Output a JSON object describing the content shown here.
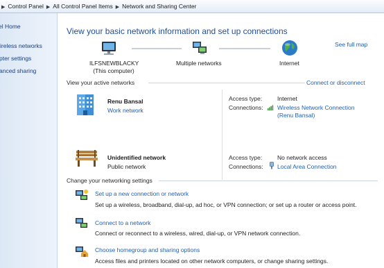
{
  "breadcrumb": {
    "items": [
      "Control Panel",
      "All Control Panel Items",
      "Network and Sharing Center"
    ]
  },
  "leftnav": {
    "items": [
      "el Home",
      "ireless networks",
      "pter settings",
      "anced sharing"
    ]
  },
  "header": {
    "title": "View your basic network information and set up connections",
    "see_full_map": "See full map"
  },
  "map": {
    "computer_name": "ILFSNEWBLACKY",
    "computer_sub": "(This computer)",
    "networks_label": "Multiple networks",
    "internet_label": "Internet"
  },
  "active": {
    "heading": "View your active networks",
    "connect_link": "Connect or disconnect",
    "networks": [
      {
        "name": "Renu Bansal",
        "type": "Work network",
        "access_label": "Access type:",
        "access_value": "Internet",
        "connections_label": "Connections:",
        "connection_line1": "Wireless Network Connection",
        "connection_line2": "(Renu Bansal)"
      },
      {
        "name": "Unidentified network",
        "type": "Public network",
        "access_label": "Access type:",
        "access_value": "No network access",
        "connections_label": "Connections:",
        "connection_line1": "Local Area Connection"
      }
    ]
  },
  "settings": {
    "heading": "Change your networking settings",
    "items": [
      {
        "title": "Set up a new connection or network",
        "desc": "Set up a wireless, broadband, dial-up, ad hoc, or VPN connection; or set up a router or access point."
      },
      {
        "title": "Connect to a network",
        "desc": "Connect or reconnect to a wireless, wired, dial-up, or VPN network connection."
      },
      {
        "title": "Choose homegroup and sharing options",
        "desc": "Access files and printers located on other network computers, or change sharing settings."
      }
    ]
  },
  "colors": {
    "link": "#1f5fb4",
    "title": "#1f4e9a"
  }
}
